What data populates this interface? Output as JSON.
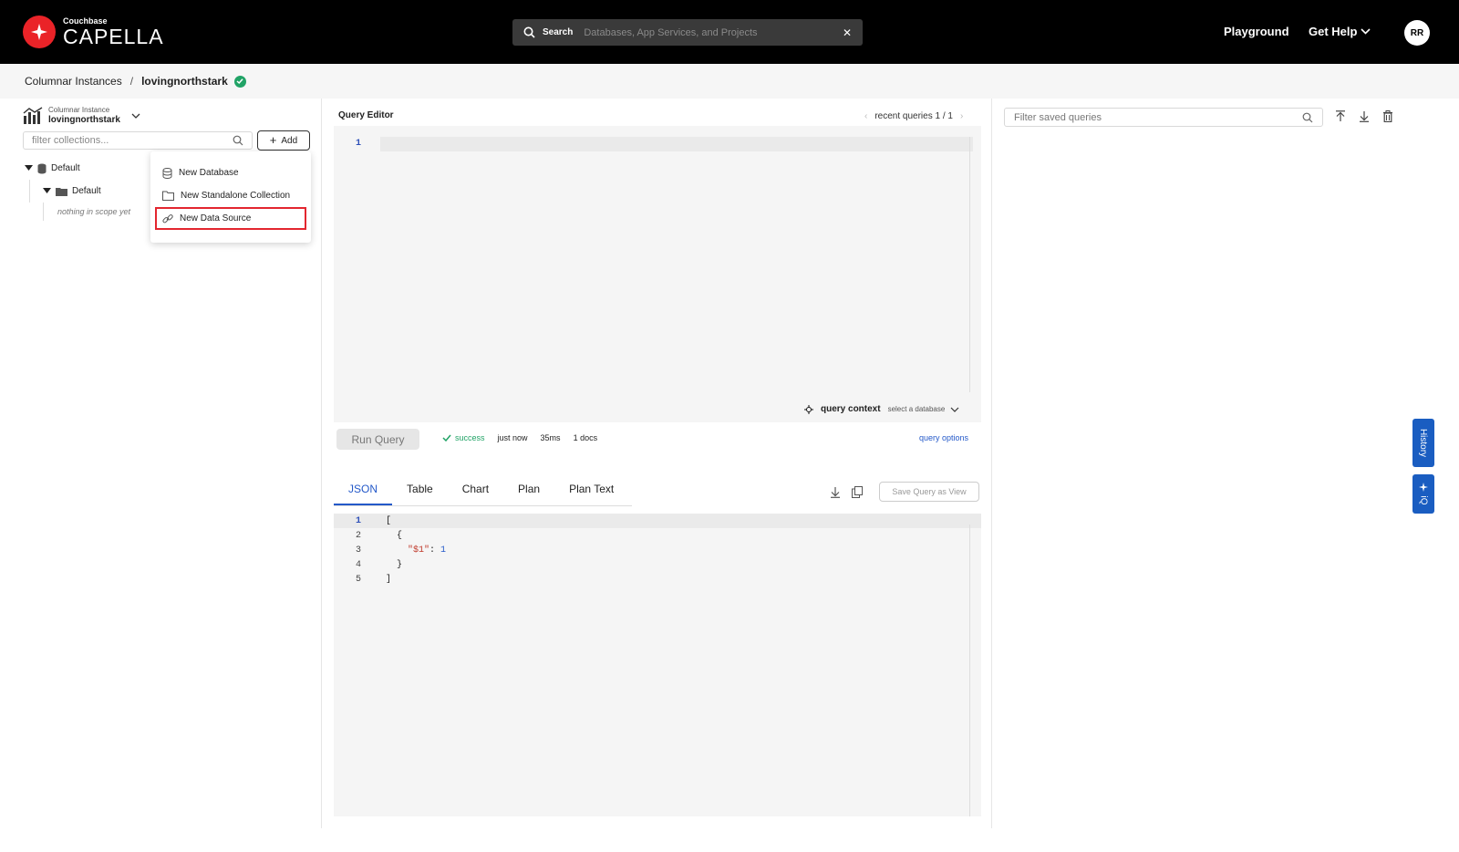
{
  "header": {
    "brand_small": "Couchbase",
    "brand_big": "CAPELLA",
    "search_label": "Search",
    "search_placeholder": "Databases, App Services, and Projects",
    "playground": "Playground",
    "get_help": "Get Help",
    "avatar_initials": "RR"
  },
  "breadcrumb": {
    "parent": "Columnar Instances",
    "separator": "/",
    "current": "lovingnorthstark"
  },
  "sidebar": {
    "instance_label": "Columnar Instance",
    "instance_name": "lovingnorthstark",
    "filter_placeholder": "filter collections...",
    "add_label": "Add",
    "tree": {
      "database": "Default",
      "scope": "Default",
      "empty": "nothing in scope yet"
    },
    "add_menu": [
      "New Database",
      "New Standalone Collection",
      "New Data Source"
    ]
  },
  "editor": {
    "title": "Query Editor",
    "recent_label": "recent queries",
    "recent_count": "1 / 1",
    "line_number": "1",
    "query_context_label": "query context",
    "query_context_value": "select a database",
    "run_label": "Run Query",
    "status": "success",
    "time": "just now",
    "duration": "35ms",
    "docs": "1 docs",
    "query_options": "query options"
  },
  "results": {
    "tabs": [
      "JSON",
      "Table",
      "Chart",
      "Plan",
      "Plan Text"
    ],
    "active_tab": "JSON",
    "save_view": "Save Query as View",
    "lines": [
      {
        "n": "1",
        "code": "["
      },
      {
        "n": "2",
        "code": "  {"
      },
      {
        "n": "3",
        "key": "    \"$1\"",
        "sep": ": ",
        "val": "1"
      },
      {
        "n": "4",
        "code": "  }"
      },
      {
        "n": "5",
        "code": "]"
      }
    ]
  },
  "saved_queries": {
    "filter_placeholder": "Filter saved queries"
  },
  "side_tabs": {
    "history": "History",
    "iq": "iQ"
  },
  "colors": {
    "accent": "#2459c9",
    "brand": "#ea2328",
    "success": "#21a366",
    "highlight": "#e3262f"
  }
}
